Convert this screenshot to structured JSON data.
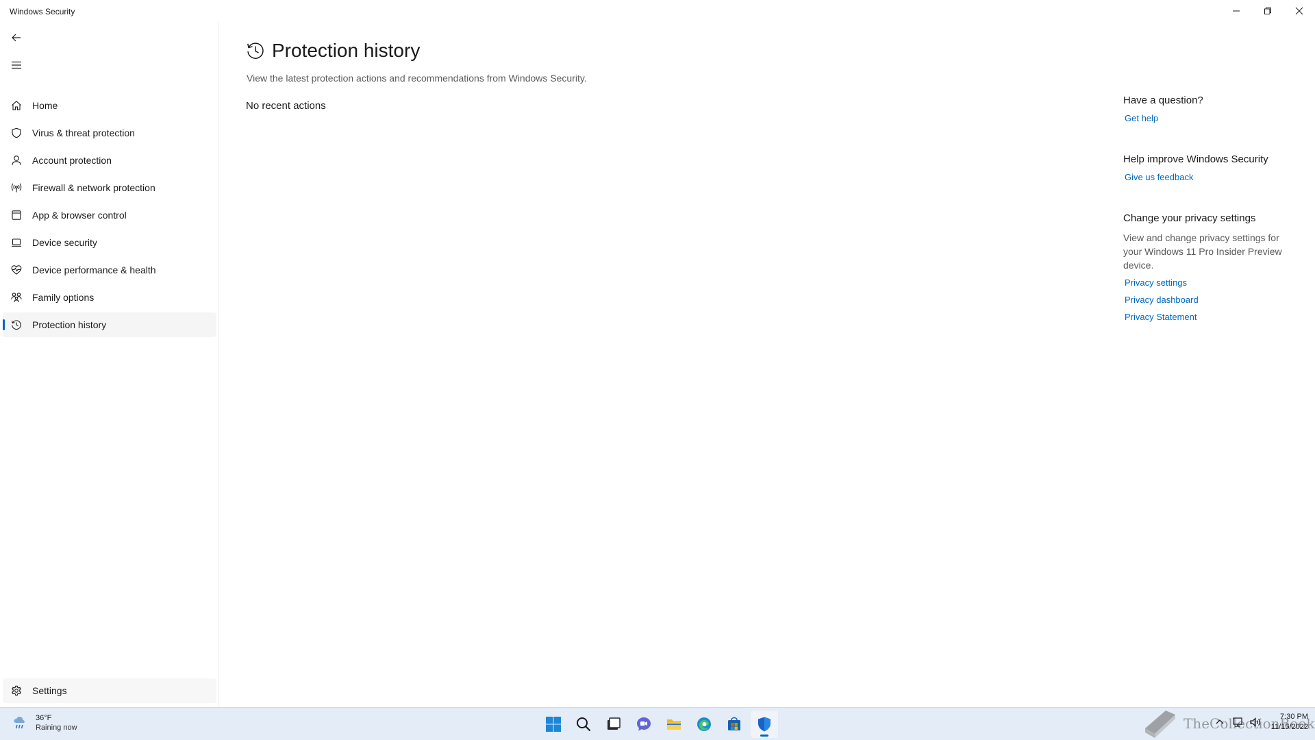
{
  "window": {
    "title": "Windows Security"
  },
  "sidebar": {
    "items": [
      {
        "label": "Home",
        "icon": "home-icon"
      },
      {
        "label": "Virus & threat protection",
        "icon": "shield-icon"
      },
      {
        "label": "Account protection",
        "icon": "person-icon"
      },
      {
        "label": "Firewall & network protection",
        "icon": "antenna-icon"
      },
      {
        "label": "App & browser control",
        "icon": "window-icon"
      },
      {
        "label": "Device security",
        "icon": "laptop-icon"
      },
      {
        "label": "Device performance & health",
        "icon": "heart-pulse-icon"
      },
      {
        "label": "Family options",
        "icon": "family-icon"
      },
      {
        "label": "Protection history",
        "icon": "history-icon",
        "active": true
      }
    ],
    "settings_label": "Settings"
  },
  "main": {
    "title": "Protection history",
    "description": "View the latest protection actions and recommendations from Windows Security.",
    "empty_message": "No recent actions"
  },
  "right_pane": {
    "question_heading": "Have a question?",
    "get_help": "Get help",
    "improve_heading": "Help improve Windows Security",
    "feedback": "Give us feedback",
    "privacy_heading": "Change your privacy settings",
    "privacy_text": "View and change privacy settings for your Windows 11 Pro Insider Preview device.",
    "privacy_settings": "Privacy settings",
    "privacy_dashboard": "Privacy dashboard",
    "privacy_statement": "Privacy Statement"
  },
  "taskbar": {
    "weather_temp": "36°F",
    "weather_desc": "Raining now",
    "time": "7:30 PM",
    "date": "11/15/2022",
    "watermark": "TheCollectionBook"
  },
  "colors": {
    "accent": "#0067c0",
    "taskbar": "#e3ecf7"
  }
}
